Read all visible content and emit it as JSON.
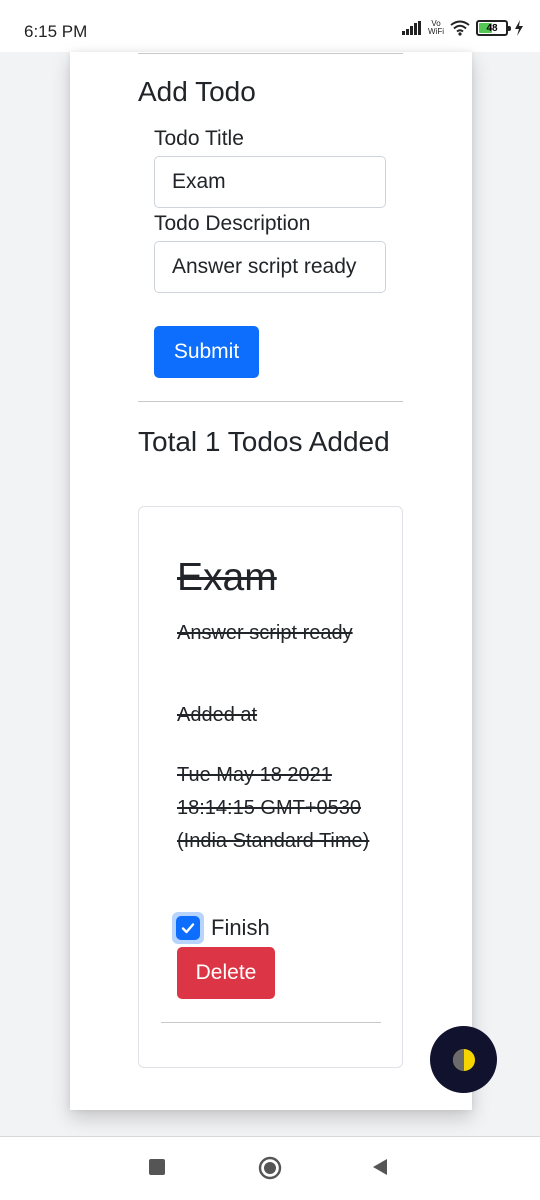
{
  "status_bar": {
    "time": "6:15 PM",
    "battery_level": "48",
    "vowifi": "Vo\nWiFi"
  },
  "form": {
    "heading": "Add Todo",
    "title_label": "Todo Title",
    "title_value": "Exam",
    "description_label": "Todo Description",
    "description_value": "Answer script ready",
    "submit_label": "Submit"
  },
  "todos_heading": "Total 1 Todos Added",
  "todo": {
    "title": "Exam",
    "description": "Answer script ready",
    "added_at_label": "Added at",
    "date": "Tue May 18 2021 18:14:15 GMT+0530 (India Standard Time)",
    "finish_label": "Finish",
    "finished": true,
    "delete_label": "Delete"
  },
  "colors": {
    "primary": "#0d6efd",
    "danger": "#dc3545",
    "fab_bg": "#10122e",
    "fab_icon": "#f5d400"
  },
  "icons": {
    "fab": "half-moon-theme-icon",
    "nav_recent": "square-icon",
    "nav_home": "circle-icon",
    "nav_back": "triangle-back-icon"
  }
}
